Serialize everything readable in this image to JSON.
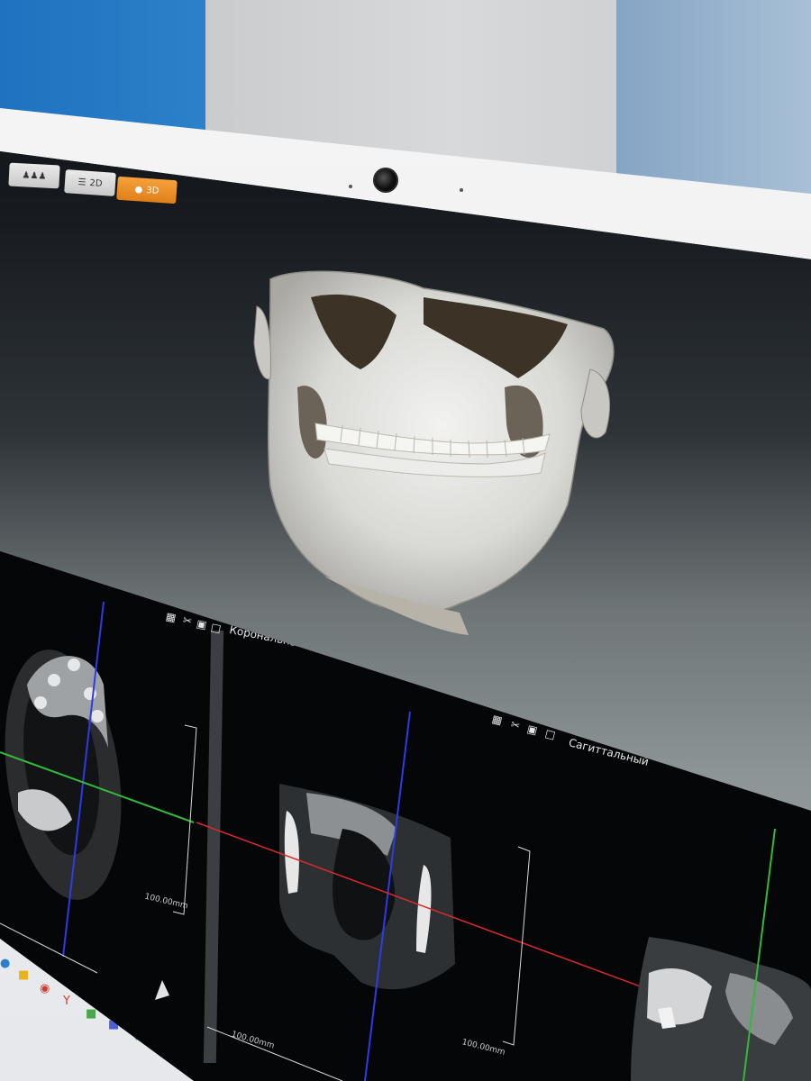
{
  "tabs": {
    "people_icon": "people-icon",
    "t2d": "2D",
    "t3d": "3D"
  },
  "panels": {
    "coronal_label": "Корональный",
    "sagittal_label": "Сагиттальный",
    "scale_axial": "100.00mm",
    "scale_coronal_bottom": "100.00mm",
    "scale_coronal_right": "100.00mm"
  },
  "colors": {
    "accent": "#e8871e",
    "crosshair_blue": "#2d3ce6",
    "crosshair_red": "#d92a2a",
    "crosshair_green": "#34b83a"
  },
  "toolbar_icons": [
    "layout-icon",
    "scissors-icon",
    "camera-icon",
    "crop-icon"
  ]
}
